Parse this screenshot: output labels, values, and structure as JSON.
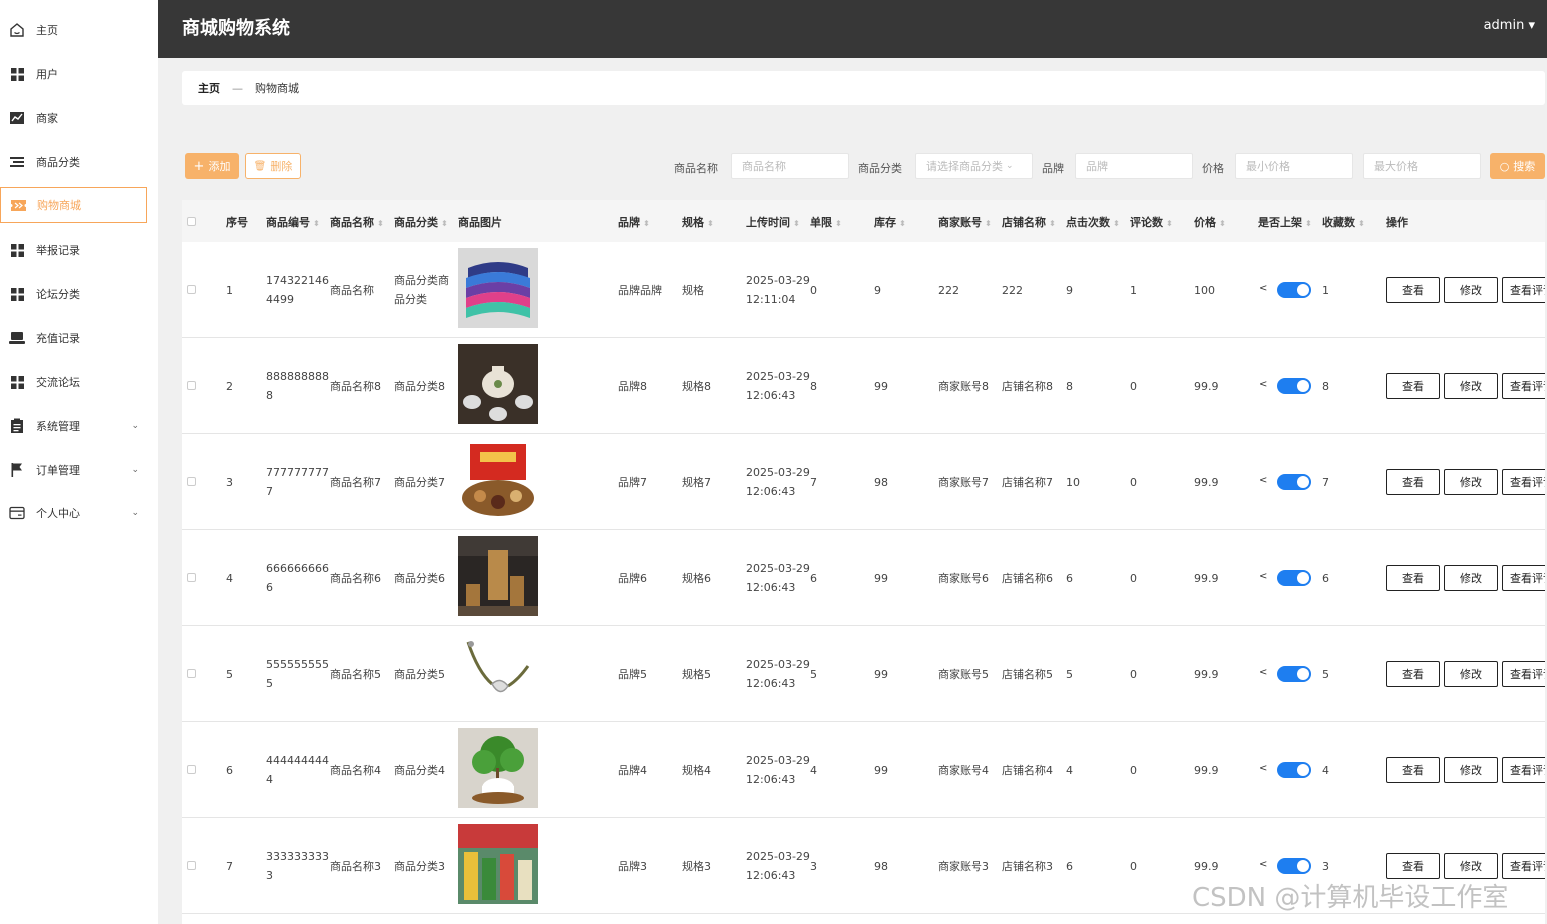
{
  "sidebar": {
    "items": [
      {
        "label": "主页",
        "icon": "home-icon"
      },
      {
        "label": "用户",
        "icon": "grid-icon"
      },
      {
        "label": "商家",
        "icon": "chart-icon"
      },
      {
        "label": "商品分类",
        "icon": "list-icon"
      },
      {
        "label": "购物商城",
        "icon": "ticket-icon",
        "active": true
      },
      {
        "label": "举报记录",
        "icon": "grid-icon"
      },
      {
        "label": "论坛分类",
        "icon": "grid-icon"
      },
      {
        "label": "充值记录",
        "icon": "laptop-icon"
      },
      {
        "label": "交流论坛",
        "icon": "grid-icon"
      },
      {
        "label": "系统管理",
        "icon": "clipboard-icon",
        "expandable": true
      },
      {
        "label": "订单管理",
        "icon": "flag-icon",
        "expandable": true
      },
      {
        "label": "个人中心",
        "icon": "card-icon",
        "expandable": true
      }
    ]
  },
  "header": {
    "title": "商城购物系统",
    "user": "admin"
  },
  "breadcrumb": {
    "home": "主页",
    "sep": "—",
    "current": "购物商城"
  },
  "toolbar": {
    "add_label": "添加",
    "delete_label": "删除",
    "name_label": "商品名称",
    "name_placeholder": "商品名称",
    "category_label": "商品分类",
    "category_placeholder": "请选择商品分类",
    "brand_label": "品牌",
    "brand_placeholder": "品牌",
    "price_label": "价格",
    "min_placeholder": "最小价格",
    "max_placeholder": "最大价格",
    "search_label": "搜索"
  },
  "columns": [
    "序号",
    "商品编号",
    "商品名称",
    "商品分类",
    "商品图片",
    "品牌",
    "规格",
    "上传时间",
    "单限",
    "库存",
    "商家账号",
    "店铺名称",
    "点击次数",
    "评论数",
    "价格",
    "是否上架",
    "收藏数",
    "操作"
  ],
  "actions": {
    "view": "查看",
    "edit": "修改",
    "reviews": "查看评论"
  },
  "rows": [
    {
      "idx": "1",
      "code1": "174322146",
      "code2": "4499",
      "name": "商品名称",
      "cat1": "商品分类商",
      "cat2": "品分类",
      "brand": "品牌品牌",
      "spec": "规格",
      "date": "2025-03-29",
      "time": "12:11:04",
      "limit": "0",
      "stock": "9",
      "merchant": "222",
      "shop": "222",
      "clicks": "9",
      "comments": "1",
      "price": "100",
      "fav": "1"
    },
    {
      "idx": "2",
      "code1": "888888888",
      "code2": "8",
      "name": "商品名称8",
      "cat1": "商品分类8",
      "cat2": "",
      "brand": "品牌8",
      "spec": "规格8",
      "date": "2025-03-29",
      "time": "12:06:43",
      "limit": "8",
      "stock": "99",
      "merchant": "商家账号8",
      "shop": "店铺名称8",
      "clicks": "8",
      "comments": "0",
      "price": "99.9",
      "fav": "8"
    },
    {
      "idx": "3",
      "code1": "777777777",
      "code2": "7",
      "name": "商品名称7",
      "cat1": "商品分类7",
      "cat2": "",
      "brand": "品牌7",
      "spec": "规格7",
      "date": "2025-03-29",
      "time": "12:06:43",
      "limit": "7",
      "stock": "98",
      "merchant": "商家账号7",
      "shop": "店铺名称7",
      "clicks": "10",
      "comments": "0",
      "price": "99.9",
      "fav": "7"
    },
    {
      "idx": "4",
      "code1": "666666666",
      "code2": "6",
      "name": "商品名称6",
      "cat1": "商品分类6",
      "cat2": "",
      "brand": "品牌6",
      "spec": "规格6",
      "date": "2025-03-29",
      "time": "12:06:43",
      "limit": "6",
      "stock": "99",
      "merchant": "商家账号6",
      "shop": "店铺名称6",
      "clicks": "6",
      "comments": "0",
      "price": "99.9",
      "fav": "6"
    },
    {
      "idx": "5",
      "code1": "555555555",
      "code2": "5",
      "name": "商品名称5",
      "cat1": "商品分类5",
      "cat2": "",
      "brand": "品牌5",
      "spec": "规格5",
      "date": "2025-03-29",
      "time": "12:06:43",
      "limit": "5",
      "stock": "99",
      "merchant": "商家账号5",
      "shop": "店铺名称5",
      "clicks": "5",
      "comments": "0",
      "price": "99.9",
      "fav": "5"
    },
    {
      "idx": "6",
      "code1": "444444444",
      "code2": "4",
      "name": "商品名称4",
      "cat1": "商品分类4",
      "cat2": "",
      "brand": "品牌4",
      "spec": "规格4",
      "date": "2025-03-29",
      "time": "12:06:43",
      "limit": "4",
      "stock": "99",
      "merchant": "商家账号4",
      "shop": "店铺名称4",
      "clicks": "4",
      "comments": "0",
      "price": "99.9",
      "fav": "4"
    },
    {
      "idx": "7",
      "code1": "333333333",
      "code2": "3",
      "name": "商品名称3",
      "cat1": "商品分类3",
      "cat2": "",
      "brand": "品牌3",
      "spec": "规格3",
      "date": "2025-03-29",
      "time": "12:06:43",
      "limit": "3",
      "stock": "98",
      "merchant": "商家账号3",
      "shop": "店铺名称3",
      "clicks": "6",
      "comments": "0",
      "price": "99.9",
      "fav": "3"
    }
  ],
  "watermark": "CSDN @计算机毕设工作室"
}
